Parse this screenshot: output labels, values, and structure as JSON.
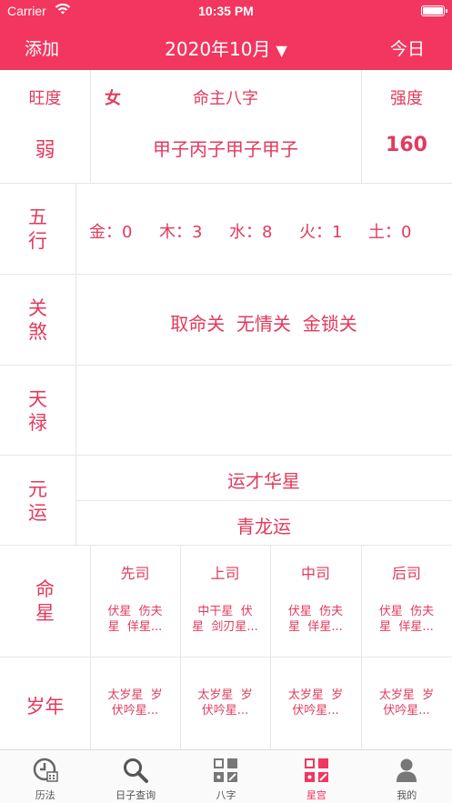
{
  "status_bar": {
    "carrier": "Carrier",
    "time": "10:35 PM"
  },
  "nav": {
    "left": "添加",
    "title": "2020年10月",
    "caret": "▼",
    "right": "今日"
  },
  "bazi": {
    "strength_label": "旺度",
    "strength_value": "弱",
    "gender": "女",
    "chart_label": "命主八字",
    "chart_value": "甲子丙子甲子甲子",
    "score_label": "强度",
    "score_value": "160"
  },
  "wuxing": {
    "label_1": "五",
    "label_2": "行",
    "items": [
      {
        "name": "金：0"
      },
      {
        "name": "木：3"
      },
      {
        "name": "水：8"
      },
      {
        "name": "火：1"
      },
      {
        "name": "土：0"
      }
    ]
  },
  "guansha": {
    "label_1": "关",
    "label_2": "煞",
    "value": "取命关  无情关  金锁关"
  },
  "tianlu": {
    "label_1": "天",
    "label_2": "禄",
    "value": ""
  },
  "yuanyun": {
    "label_1": "元",
    "label_2": "运",
    "value_1": "运才华星",
    "value_2": "青龙运"
  },
  "mingxing": {
    "label_1": "命",
    "label_2": "星",
    "columns": [
      {
        "header": "先司",
        "line1": "伏星  伤夫",
        "line2": "星  佯星..."
      },
      {
        "header": "上司",
        "line1": "中干星  伏",
        "line2": "星  剑刃星..."
      },
      {
        "header": "中司",
        "line1": "伏星  伤夫",
        "line2": "星  佯星..."
      },
      {
        "header": "后司",
        "line1": "伏星  伤夫",
        "line2": "星  佯星..."
      }
    ]
  },
  "suinian": {
    "label": "岁年",
    "columns": [
      {
        "line1": "太岁星  岁",
        "line2": "伏吟星..."
      },
      {
        "line1": "太岁星  岁",
        "line2": "伏吟星..."
      },
      {
        "line1": "太岁星  岁",
        "line2": "伏吟星..."
      },
      {
        "line1": "太岁星  岁",
        "line2": "伏吟星..."
      }
    ]
  },
  "tabs": [
    {
      "label": "历法",
      "icon": "calendar-clock-icon"
    },
    {
      "label": "日子查询",
      "icon": "search-icon"
    },
    {
      "label": "八字",
      "icon": "grid-icon"
    },
    {
      "label": "星宫",
      "icon": "grid-icon",
      "active": true
    },
    {
      "label": "我的",
      "icon": "person-icon"
    }
  ],
  "colors": {
    "accent": "#f2365f",
    "text": "#e23a5e",
    "tab_inactive": "#555555"
  }
}
